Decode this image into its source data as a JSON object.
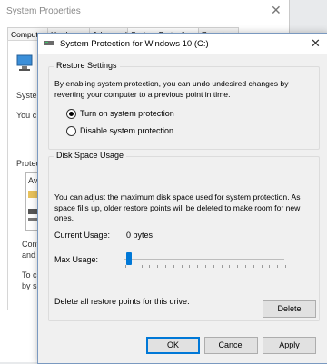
{
  "background_window": {
    "title": "System Properties",
    "close_glyph": "✕",
    "tabs": [
      "Computer Name",
      "Hardware",
      "Advanced",
      "System Protection",
      "Remote"
    ],
    "texts": [
      "Syste",
      "You c",
      "Protect",
      "Ava",
      "Confi",
      "and de",
      "To cr",
      "by se"
    ]
  },
  "dialog": {
    "title": "System Protection for Windows 10 (C:)",
    "close_glyph": "✕",
    "restore_settings": {
      "legend": "Restore Settings",
      "description": "By enabling system protection, you can undo undesired changes by reverting your computer to a previous point in time.",
      "options": [
        {
          "label": "Turn on system protection",
          "selected": true
        },
        {
          "label": "Disable system protection",
          "selected": false
        }
      ]
    },
    "disk_space": {
      "legend": "Disk Space Usage",
      "description": "You can adjust the maximum disk space used for system protection. As space fills up, older restore points will be deleted to make room for new ones.",
      "current_usage_label": "Current Usage:",
      "current_usage_value": "0 bytes",
      "max_usage_label": "Max Usage:",
      "max_usage_fraction": 0.0,
      "delete_text": "Delete all restore points for this drive.",
      "delete_button": "Delete"
    },
    "buttons": {
      "ok": "OK",
      "cancel": "Cancel",
      "apply": "Apply"
    },
    "accent_color": "#0078d7"
  }
}
